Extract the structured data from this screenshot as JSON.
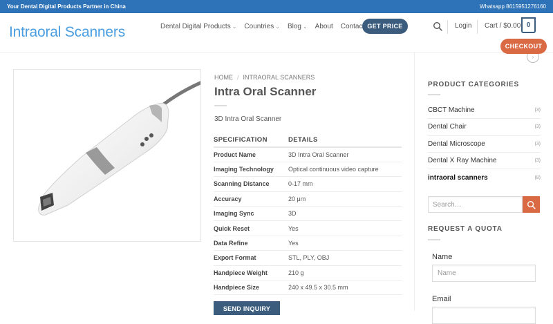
{
  "topbar": {
    "tagline": "Your Dental Digital Products Partner in China",
    "contact": "Whatsapp 8615951276160"
  },
  "header": {
    "logo": "Intraoral Scanners",
    "nav": [
      {
        "label": "Dental Digital Products",
        "dropdown": true
      },
      {
        "label": "Countries",
        "dropdown": true
      },
      {
        "label": "Blog",
        "dropdown": true
      },
      {
        "label": "About",
        "dropdown": false
      },
      {
        "label": "Contact",
        "dropdown": false
      }
    ],
    "get_price": "GET PRICE",
    "login": "Login",
    "cart": "Cart / $0.00",
    "cart_count": "0",
    "checkout": "CHECKOUT"
  },
  "breadcrumb": [
    "HOME",
    "INTRAORAL SCANNERS"
  ],
  "product": {
    "title": "Intra Oral Scanner",
    "subtitle": "3D Intra Oral Scanner",
    "spec_headers": [
      "SPECIFICATION",
      "DETAILS"
    ],
    "specs": [
      {
        "k": "Product Name",
        "v": "3D Intra Oral Scanner"
      },
      {
        "k": "Imaging Technology",
        "v": "Optical continuous video capture"
      },
      {
        "k": "Scanning Distance",
        "v": "0-17 mm"
      },
      {
        "k": "Accuracy",
        "v": "20 μm"
      },
      {
        "k": "Imaging Sync",
        "v": "3D"
      },
      {
        "k": "Quick Reset",
        "v": "Yes"
      },
      {
        "k": "Data Refine",
        "v": "Yes"
      },
      {
        "k": "Export Format",
        "v": "STL, PLY, OBJ"
      },
      {
        "k": "Handpiece Weight",
        "v": "210 g"
      },
      {
        "k": "Handpiece Size",
        "v": "240 x 49.5 x 30.5 mm"
      }
    ],
    "send_inquiry": "SEND INQUIRY"
  },
  "sidebar": {
    "categories_heading": "PRODUCT CATEGORIES",
    "categories": [
      {
        "name": "CBCT Machine",
        "count": "(3)",
        "active": false
      },
      {
        "name": "Dental Chair",
        "count": "(3)",
        "active": false
      },
      {
        "name": "Dental Microscope",
        "count": "(3)",
        "active": false
      },
      {
        "name": "Dental X Ray Machine",
        "count": "(3)",
        "active": false
      },
      {
        "name": "intraoral scanners",
        "count": "(8)",
        "active": true
      }
    ],
    "search_placeholder": "Search…",
    "quota_heading": "REQUEST A QUOTA",
    "name_label": "Name",
    "name_placeholder": "Name",
    "email_label": "Email"
  },
  "colors": {
    "topbar": "#2e73b8",
    "logo": "#4a9ee0",
    "primary_button": "#3b5c7d",
    "accent": "#d96a43"
  },
  "icons": [
    "search-icon",
    "chevron-down-icon",
    "up-arrow-icon"
  ]
}
